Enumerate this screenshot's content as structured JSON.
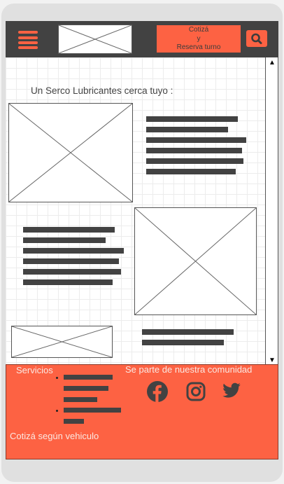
{
  "header": {
    "menu_icon": "hamburger-icon",
    "logo": "logo-placeholder",
    "cta_line1": "Cotizá",
    "cta_line2": "y",
    "cta_line3": "Reserva turno",
    "search_icon": "search-icon"
  },
  "main": {
    "heading": "Un Serco Lubricantes cerca tuyo :"
  },
  "footer": {
    "services_title": "Servicios",
    "community_title": "Se parte de nuestra comunidad",
    "quote_link": "Cotizá según vehiculo",
    "social": [
      "facebook-icon",
      "instagram-icon",
      "twitter-icon"
    ]
  },
  "colors": {
    "accent": "#fd6243",
    "dark": "#424242"
  }
}
